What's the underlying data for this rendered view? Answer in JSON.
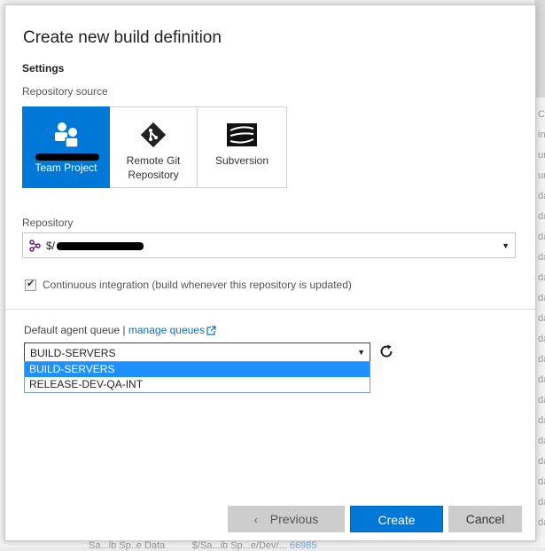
{
  "dialog": {
    "title": "Create new build definition",
    "section": "Settings",
    "repository_source_label": "Repository source",
    "sources": [
      {
        "line1": "",
        "line2": "Team Project",
        "selected": true,
        "icon": "team-project-icon"
      },
      {
        "line1": "Remote Git",
        "line2": "Repository",
        "selected": false,
        "icon": "git-icon"
      },
      {
        "line1": "Subversion",
        "line2": "",
        "selected": false,
        "icon": "subversion-icon"
      }
    ],
    "repository_label": "Repository",
    "repository_value": "$/",
    "ci_checked": true,
    "ci_label": "Continuous integration (build whenever this repository is updated)",
    "queue_label": "Default agent queue |",
    "manage_queues_link": "manage queues",
    "queue_selected": "BUILD-SERVERS",
    "queue_options": [
      "BUILD-SERVERS",
      "RELEASE-DEV-QA-INT"
    ],
    "buttons": {
      "previous": "Previous",
      "create": "Create",
      "cancel": "Cancel"
    }
  },
  "background": {
    "right_fragments": [
      "C",
      "in",
      "un",
      "un",
      "da",
      "da",
      "da",
      "da",
      "da",
      "da",
      "da",
      "da",
      "da",
      "da",
      "da",
      "da",
      "da",
      "da",
      "da",
      "da",
      "da",
      "da",
      "da",
      "da"
    ],
    "bottom_text": "Sa...ib Sp..e Data",
    "bottom_path": "$/Sa...ib Sp...e/Dev/...",
    "bottom_link": "66985"
  },
  "colors": {
    "accent": "#0078d7",
    "selected_option": "#1e90ff",
    "link": "#106ebe"
  }
}
